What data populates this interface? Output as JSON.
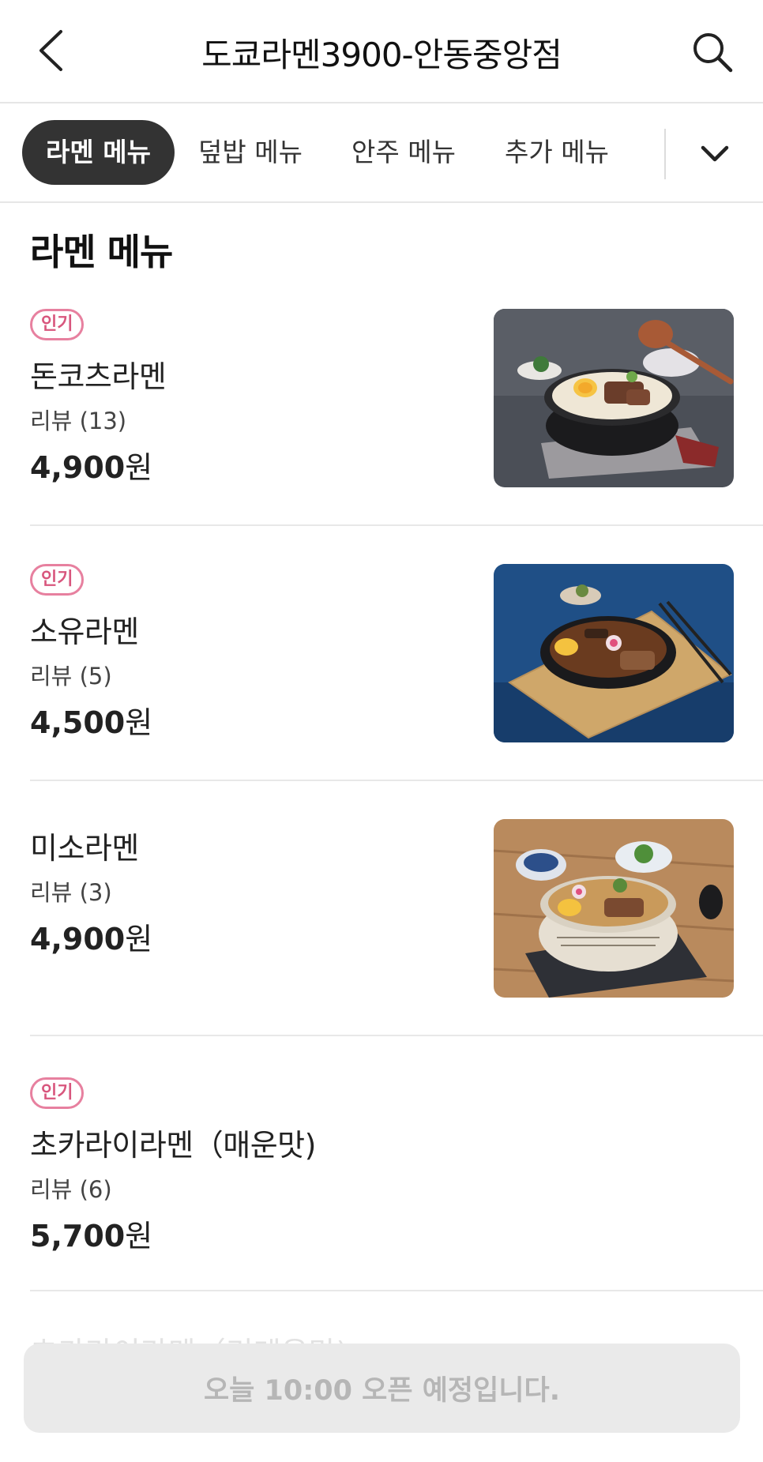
{
  "header": {
    "title": "도쿄라멘3900-안동중앙점",
    "back_icon": "chevron-left-icon",
    "search_icon": "search-icon"
  },
  "tabs": [
    {
      "label": "라멘 메뉴",
      "active": true
    },
    {
      "label": "덮밥 메뉴",
      "active": false
    },
    {
      "label": "안주 메뉴",
      "active": false
    },
    {
      "label": "추가 메뉴",
      "active": false
    }
  ],
  "tabs_more_icon": "chevron-down-icon",
  "section": {
    "title": "라멘 메뉴"
  },
  "items": [
    {
      "badge": "인기",
      "name": "돈코츠라멘",
      "review": "리뷰 (13)",
      "price_number": "4,900",
      "price_unit": "원",
      "image": "tonkotsu-ramen-photo"
    },
    {
      "badge": "인기",
      "name": "소유라멘",
      "review": "리뷰 (5)",
      "price_number": "4,500",
      "price_unit": "원",
      "image": "shoyu-ramen-photo"
    },
    {
      "badge": "",
      "name": "미소라멘",
      "review": "리뷰 (3)",
      "price_number": "4,900",
      "price_unit": "원",
      "image": "miso-ramen-photo"
    },
    {
      "badge": "인기",
      "name": "초카라이라멘（매운맛)",
      "review": "리뷰 (6)",
      "price_number": "5,700",
      "price_unit": "원",
      "image": ""
    }
  ],
  "next_item_partial": "초카라이라멘（리메운맛)",
  "footer": {
    "notice": "오늘 10:00 오픈 예정입니다."
  },
  "colors": {
    "badge": "#d8567d",
    "active_tab": "#333333",
    "footer_bg": "#eaeaea"
  }
}
